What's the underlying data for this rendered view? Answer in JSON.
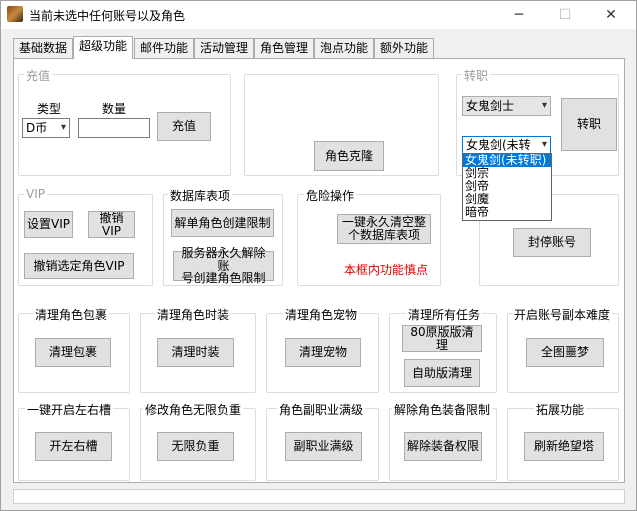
{
  "window": {
    "title": "当前未选中任何账号以及角色",
    "minimize": "─",
    "maximize": "☐",
    "close": "✕"
  },
  "tabs": [
    "基础数据",
    "超级功能",
    "邮件功能",
    "活动管理",
    "角色管理",
    "泡点功能",
    "额外功能"
  ],
  "recharge": {
    "label": "充值",
    "type_label": "类型",
    "amount_label": "数量",
    "currency_value": "D币",
    "amount_value": "",
    "submit": "充值"
  },
  "clone": {
    "button": "角色克隆"
  },
  "job_change": {
    "label": "转职",
    "class_value": "女鬼剑士",
    "sub_value": "女鬼剑(未转",
    "button": "转职",
    "options": [
      "女鬼剑(未转职)",
      "剑宗",
      "剑帝",
      "剑魔",
      "暗帝"
    ]
  },
  "vip": {
    "label": "VIP",
    "set": "设置VIP",
    "cancel": "撤销VIP",
    "cancel_selected": "撤销选定角色VIP"
  },
  "db": {
    "label": "数据库表项",
    "unlock_single": "解单角色创建限制",
    "unlock_perm_l1": "服务器永久解除账",
    "unlock_perm_l2": "号创建角色限制"
  },
  "danger": {
    "label": "危险操作",
    "clear_l1": "一键永久清空整",
    "clear_l2": "个数据库表项",
    "warning": "本框内功能慎点"
  },
  "ban": {
    "button": "封停账号"
  },
  "row1": [
    {
      "label": "清理角色包裹",
      "button": "清理包裹"
    },
    {
      "label": "清理角色时装",
      "button": "清理时装"
    },
    {
      "label": "清理角色宠物",
      "button": "清理宠物"
    },
    {
      "label": "清理所有任务",
      "button": "80原版版清理",
      "button2": "自助版清理"
    },
    {
      "label": "开启账号副本难度",
      "button": "全图噩梦"
    }
  ],
  "row2": [
    {
      "label": "一键开启左右槽",
      "button": "开左右槽"
    },
    {
      "label": "修改角色无限负重",
      "button": "无限负重"
    },
    {
      "label": "角色副职业满级",
      "button": "副职业满级"
    },
    {
      "label": "解除角色装备限制",
      "button": "解除装备权限"
    },
    {
      "label": "拓展功能",
      "button": "刷新绝望塔"
    }
  ],
  "icons": {
    "app": "game-avatar-icon",
    "chevron": "▾"
  }
}
